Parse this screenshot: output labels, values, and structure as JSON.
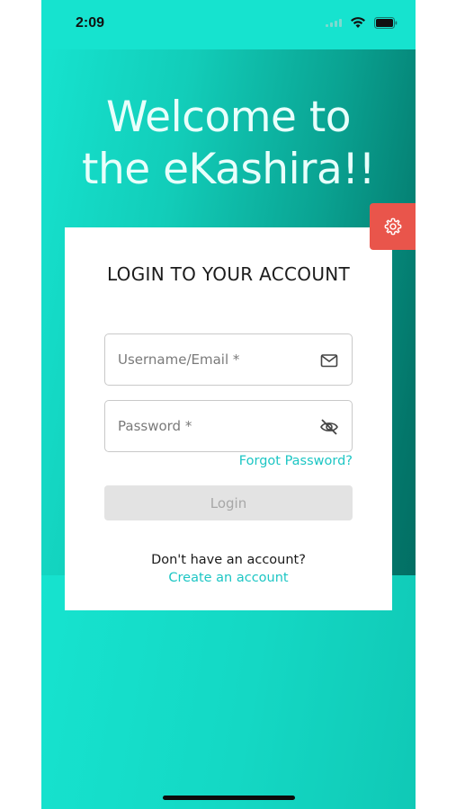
{
  "status_bar": {
    "time": "2:09"
  },
  "header": {
    "welcome_line1": "Welcome to",
    "welcome_line2": "the eKashira!!"
  },
  "login_card": {
    "title": "LOGIN TO YOUR ACCOUNT",
    "username_placeholder": "Username/Email *",
    "password_placeholder": "Password *",
    "forgot_password": "Forgot Password?",
    "login_button": "Login",
    "no_account_text": "Don't have an account?",
    "create_account_link": "Create an account"
  },
  "icons": {
    "settings": "gear-icon",
    "username": "mail-icon",
    "password": "eye-off-icon"
  },
  "colors": {
    "accent": "#1dc6c4",
    "settings_tab": "#e9554b",
    "gradient_light": "#16e3cf",
    "gradient_dark": "#02665c",
    "disabled_button": "#e3e3e3"
  }
}
